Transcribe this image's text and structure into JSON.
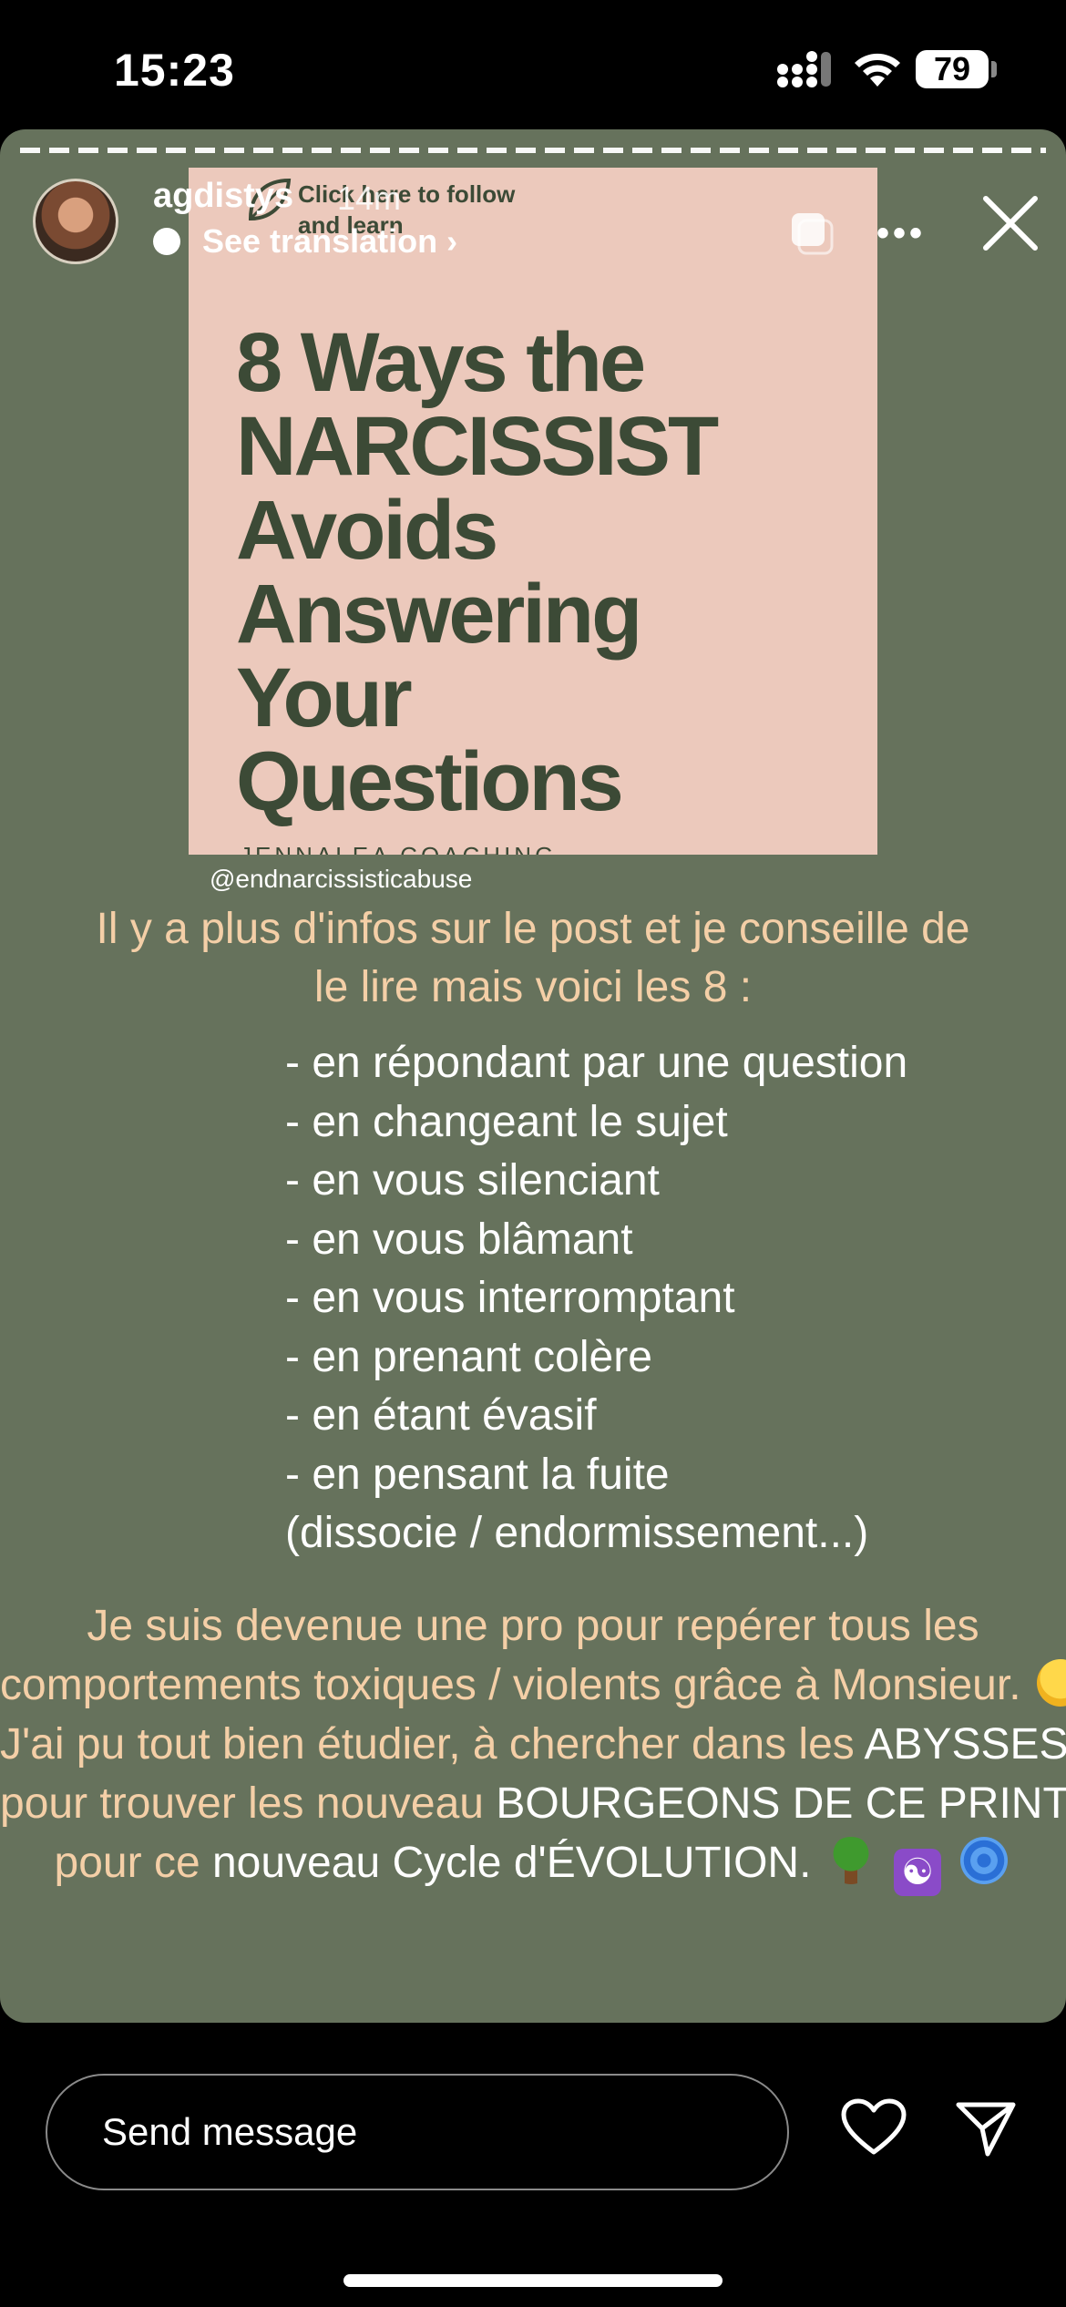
{
  "status_bar": {
    "time": "15:23",
    "battery": "79"
  },
  "story": {
    "username": "agdistys",
    "time_ago": "14m",
    "see_translation": "See translation ›",
    "sticker": {
      "top_text": "Click here to follow and learn",
      "title_lines": [
        "8 Ways the",
        "NARCISSIST",
        "Avoids",
        "Answering",
        "Your",
        "Questions"
      ],
      "footer": "JENNALEA COACHING"
    },
    "handle_tag": "@endnarcissisticabuse",
    "intro_lines": [
      "Il y a plus d'infos sur le post et je conseille de",
      "le lire mais voici les 8 :"
    ],
    "list_items": [
      "- en répondant par une question",
      "- en changeant le sujet",
      "- en vous silenciant",
      "- en vous blâmant",
      "- en vous interromptant",
      "- en prenant colère",
      "- en étant évasif",
      "- en pensant la fuite",
      "(dissocie / endormissement...)"
    ],
    "outro": {
      "line1": "Je suis devenue une pro pour repérer tous les",
      "line2": "comportements toxiques / violents grâce à Monsieur.",
      "line3_a": "J'ai pu tout bien étudier, à chercher dans les ",
      "line3_b": "ABYSSES",
      "line4_a": "pour trouver les nouveau ",
      "line4_b": "BOURGEONS DE CE PRINTEMPS",
      "line5_a": "pour ce ",
      "line5_b": "nouveau Cycle d'ÉVOLUTION."
    },
    "emojis": [
      "melting-face",
      "tree",
      "yin-yang",
      "cyclone"
    ]
  },
  "composer": {
    "placeholder": "Send message"
  },
  "colors": {
    "story_bg": "#66725c",
    "sticker_bg": "#ecc9bc",
    "sticker_text": "#3c4a36",
    "peach_text": "#f4cfa7"
  }
}
